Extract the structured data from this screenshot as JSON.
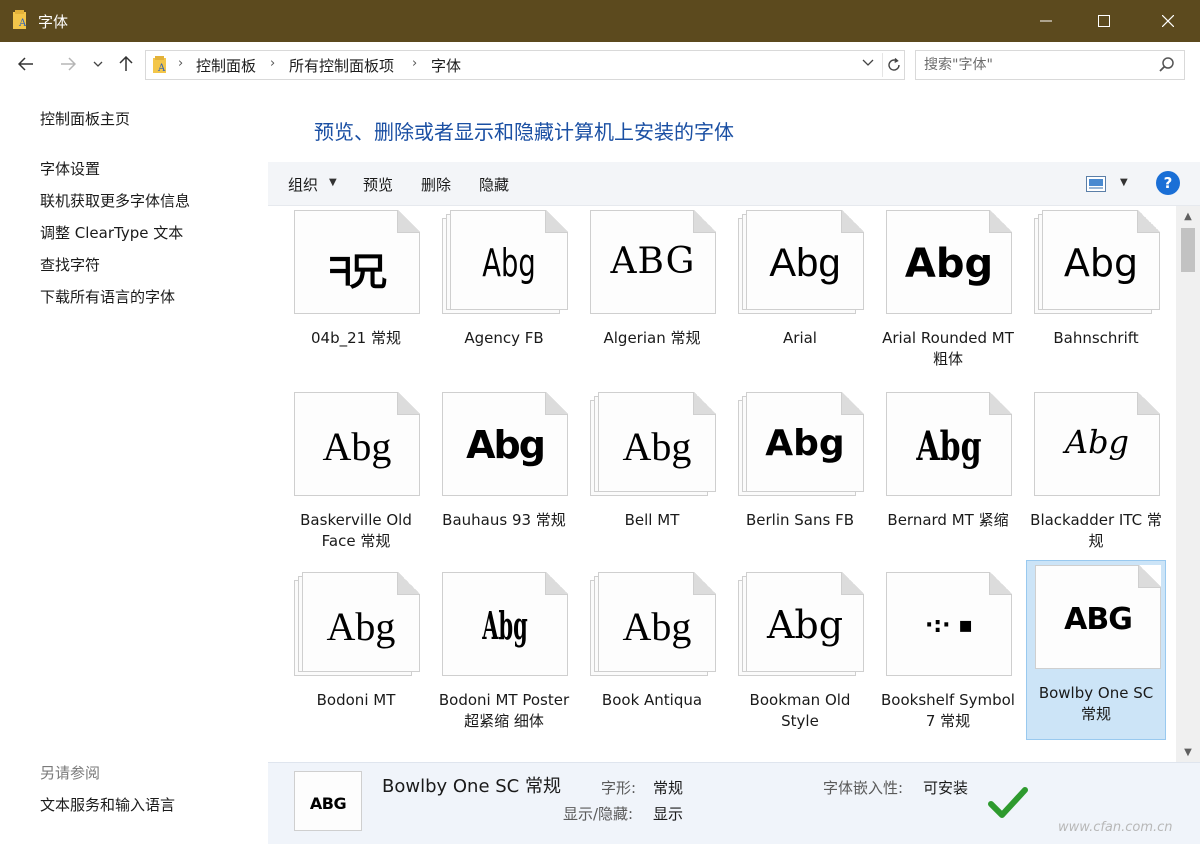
{
  "window": {
    "title": "字体"
  },
  "address": {
    "breadcrumbs": [
      "控制面板",
      "所有控制面板项",
      "字体"
    ]
  },
  "search": {
    "placeholder": "搜索\"字体\""
  },
  "left_pane": {
    "home": "控制面板主页",
    "links": [
      "字体设置",
      "联机获取更多字体信息",
      "调整 ClearType 文本",
      "查找字符",
      "下载所有语言的字体"
    ],
    "see_also_heading": "另请参阅",
    "see_also_links": [
      "文本服务和输入语言"
    ]
  },
  "main": {
    "heading": "预览、删除或者显示和隐藏计算机上安装的字体"
  },
  "toolbar": {
    "organize": "组织",
    "preview": "预览",
    "delete": "删除",
    "hide": "隐藏",
    "help": "?"
  },
  "fonts": [
    {
      "name": "04b_21 常规",
      "sample": "ᖷ兄",
      "stacked": false,
      "selected": false
    },
    {
      "name": "Agency FB",
      "sample": "Abg",
      "stacked": true,
      "selected": false
    },
    {
      "name": "Algerian 常规",
      "sample": "ABG",
      "stacked": false,
      "selected": false
    },
    {
      "name": "Arial",
      "sample": "Abg",
      "stacked": true,
      "selected": false
    },
    {
      "name": "Arial Rounded MT 粗体",
      "sample": "Abg",
      "stacked": false,
      "selected": false
    },
    {
      "name": "Bahnschrift",
      "sample": "Abg",
      "stacked": true,
      "selected": false
    },
    {
      "name": "Baskerville Old Face 常规",
      "sample": "Abg",
      "stacked": false,
      "selected": false
    },
    {
      "name": "Bauhaus 93 常规",
      "sample": "Abg",
      "stacked": false,
      "selected": false
    },
    {
      "name": "Bell MT",
      "sample": "Abg",
      "stacked": true,
      "selected": false
    },
    {
      "name": "Berlin Sans FB",
      "sample": "Abg",
      "stacked": true,
      "selected": false
    },
    {
      "name": "Bernard MT 紧缩",
      "sample": "Abg",
      "stacked": false,
      "selected": false
    },
    {
      "name": "Blackadder ITC 常规",
      "sample": "Abg",
      "stacked": false,
      "selected": false
    },
    {
      "name": "Bodoni MT",
      "sample": "Abg",
      "stacked": true,
      "selected": false
    },
    {
      "name": "Bodoni MT Poster 超紧缩 细体",
      "sample": "Abg",
      "stacked": false,
      "selected": false
    },
    {
      "name": "Book Antiqua",
      "sample": "Abg",
      "stacked": true,
      "selected": false
    },
    {
      "name": "Bookman Old Style",
      "sample": "Abg",
      "stacked": true,
      "selected": false
    },
    {
      "name": "Bookshelf Symbol 7 常规",
      "sample": "·:·  ▪",
      "stacked": false,
      "selected": false
    },
    {
      "name": "Bowlby One SC 常规",
      "sample": "ABG",
      "stacked": false,
      "selected": true
    }
  ],
  "details": {
    "thumb_sample": "ABG",
    "title": "Bowlby One SC 常规",
    "style_label": "字形:",
    "style_value": "常规",
    "show_label": "显示/隐藏:",
    "show_value": "显示",
    "embed_label": "字体嵌入性:",
    "embed_value": "可安装"
  },
  "watermark": "www.cfan.com.cn",
  "colors": {
    "titlebar": "#5c4a1e",
    "heading": "#1a4fa3",
    "selection": "#cce4f7",
    "help": "#1a6fd6",
    "check": "#3aa53a"
  }
}
